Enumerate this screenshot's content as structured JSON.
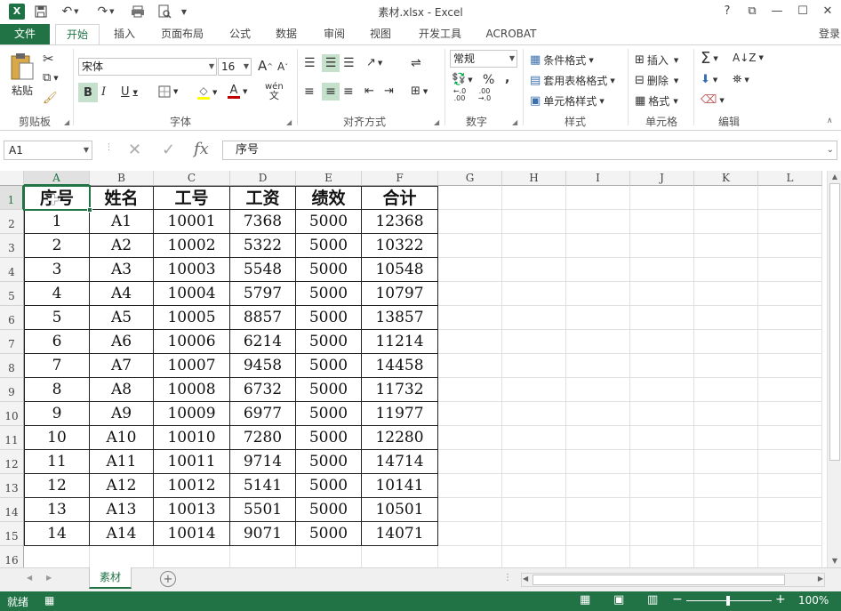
{
  "title": "素材.xlsx - Excel",
  "title_buttons": {
    "help": "?",
    "restore": "⧉",
    "minimize": "—",
    "maximize": "☐",
    "close": "✕"
  },
  "ribbon_tabs": [
    "文件",
    "开始",
    "插入",
    "页面布局",
    "公式",
    "数据",
    "审阅",
    "视图",
    "开发工具",
    "ACROBAT"
  ],
  "login": "登录",
  "ribbon": {
    "clipboard": {
      "label": "剪贴板",
      "paste": "粘贴"
    },
    "font": {
      "label": "字体",
      "name": "宋体",
      "size": "16",
      "bold": "B",
      "italic": "I",
      "underline": "U",
      "wen": "wén",
      "increase": "A",
      "decrease": "A"
    },
    "align": {
      "label": "对齐方式"
    },
    "number": {
      "label": "数字",
      "format": "常规",
      "percent": "%",
      "comma": ",",
      "inc_dec": "←.0 .00",
      "dec_dec": ".00 →.0"
    },
    "styles": {
      "label": "样式",
      "conditional": "条件格式",
      "table": "套用表格格式",
      "cell": "单元格样式"
    },
    "cells": {
      "label": "单元格",
      "insert": "插入",
      "delete": "删除",
      "format": "格式"
    },
    "editing": {
      "label": "编辑"
    }
  },
  "formula_bar": {
    "name_box": "A1",
    "cancel": "✕",
    "enter": "✓",
    "fx": "fx",
    "content": "序号"
  },
  "columns": [
    "A",
    "B",
    "C",
    "D",
    "E",
    "F",
    "G",
    "H",
    "I",
    "J",
    "K",
    "L"
  ],
  "rows": [
    "1",
    "2",
    "3",
    "4",
    "5",
    "6",
    "7",
    "8",
    "9",
    "10",
    "11",
    "12",
    "13",
    "14",
    "15",
    "16"
  ],
  "table": {
    "headers": [
      "序号",
      "姓名",
      "工号",
      "工资",
      "绩效",
      "合计"
    ],
    "rows": [
      [
        "1",
        "A1",
        "10001",
        "7368",
        "5000",
        "12368"
      ],
      [
        "2",
        "A2",
        "10002",
        "5322",
        "5000",
        "10322"
      ],
      [
        "3",
        "A3",
        "10003",
        "5548",
        "5000",
        "10548"
      ],
      [
        "4",
        "A4",
        "10004",
        "5797",
        "5000",
        "10797"
      ],
      [
        "5",
        "A5",
        "10005",
        "8857",
        "5000",
        "13857"
      ],
      [
        "6",
        "A6",
        "10006",
        "6214",
        "5000",
        "11214"
      ],
      [
        "7",
        "A7",
        "10007",
        "9458",
        "5000",
        "14458"
      ],
      [
        "8",
        "A8",
        "10008",
        "6732",
        "5000",
        "11732"
      ],
      [
        "9",
        "A9",
        "10009",
        "6977",
        "5000",
        "11977"
      ],
      [
        "10",
        "A10",
        "10010",
        "7280",
        "5000",
        "12280"
      ],
      [
        "11",
        "A11",
        "10011",
        "9714",
        "5000",
        "14714"
      ],
      [
        "12",
        "A12",
        "10012",
        "5141",
        "5000",
        "10141"
      ],
      [
        "13",
        "A13",
        "10013",
        "5501",
        "5000",
        "10501"
      ],
      [
        "14",
        "A14",
        "10014",
        "9071",
        "5000",
        "14071"
      ]
    ]
  },
  "sheet_tab": "素材",
  "status": {
    "ready": "就绪",
    "zoom": "100%"
  },
  "colors": {
    "accent": "#217346",
    "highlight": "#c5e0cb"
  }
}
